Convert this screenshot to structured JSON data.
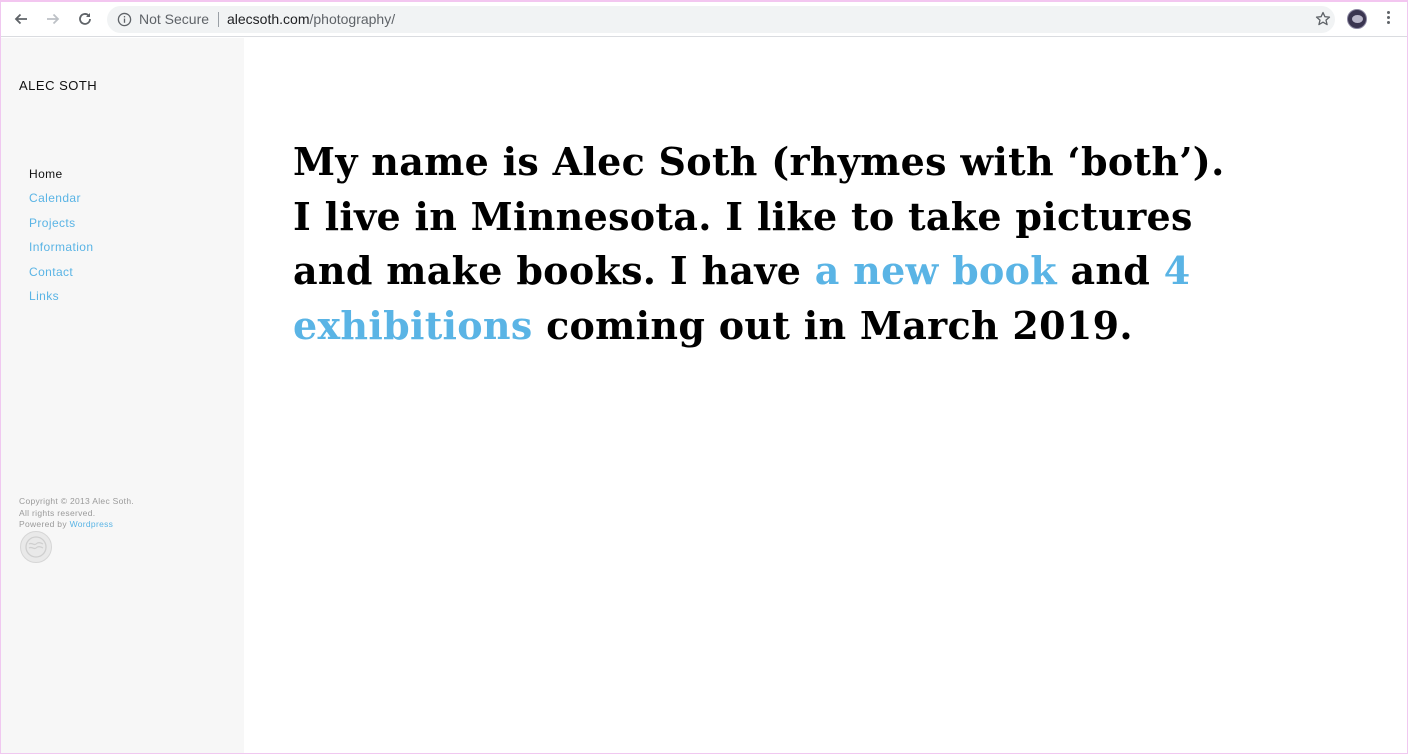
{
  "browser": {
    "security_label": "Not Secure",
    "url_host": "alecsoth.com",
    "url_path": "/photography/"
  },
  "sidebar": {
    "title": "ALEC SOTH",
    "nav": [
      {
        "label": "Home",
        "active": true
      },
      {
        "label": "Calendar"
      },
      {
        "label": "Projects"
      },
      {
        "label": "Information"
      },
      {
        "label": "Contact"
      },
      {
        "label": "Links"
      }
    ],
    "footer": {
      "copyright": "Copyright © 2013 Alec Soth.",
      "rights": "All rights reserved.",
      "powered_prefix": "Powered by",
      "powered_link": "Wordpress"
    }
  },
  "main": {
    "intro_part1": "My name is Alec Soth (rhymes with ‘both’). I live in Minnesota. I like to take pictures and make books. I have",
    "link_book": "a new book",
    "intro_part2": "and",
    "link_exhibitions": "4 exhibitions",
    "intro_part3": "coming out in March 2019."
  },
  "colors": {
    "link": "#5ab4e5",
    "sidebar_bg": "#f7f7f7"
  }
}
